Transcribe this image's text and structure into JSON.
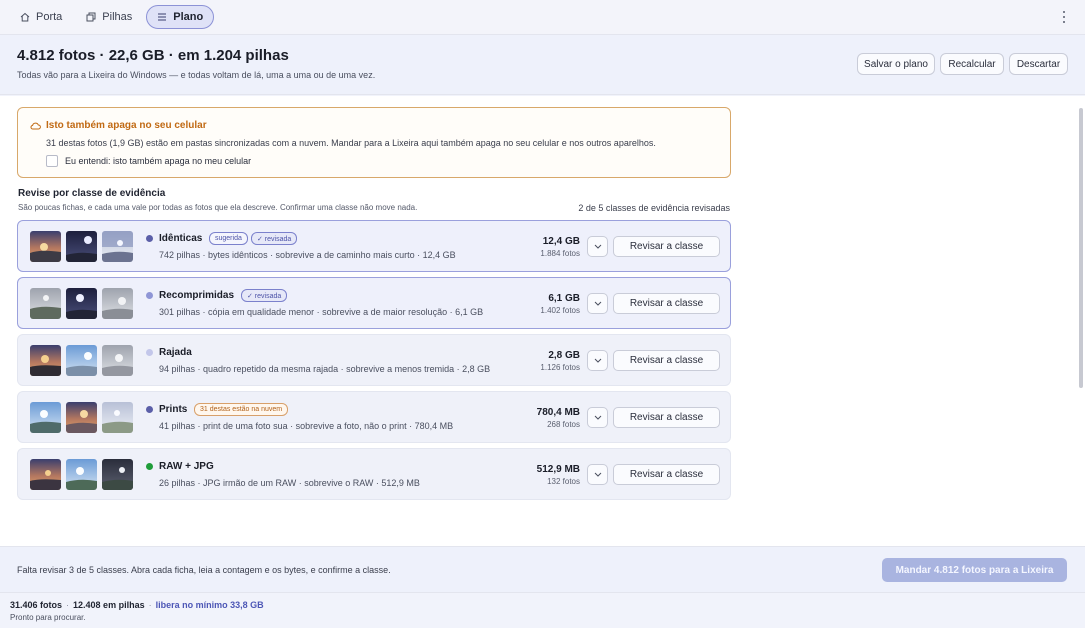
{
  "tabs": [
    {
      "label": "Porta",
      "icon": "home-icon",
      "active": false
    },
    {
      "label": "Pilhas",
      "icon": "stack-icon",
      "active": false
    },
    {
      "label": "Plano",
      "icon": "list-icon",
      "active": true
    }
  ],
  "header": {
    "title": "4.812 fotos · 22,6 GB · em 1.204 pilhas",
    "subtitle": "Todas vão para a Lixeira do Windows — e todas voltam de lá, uma a uma ou de uma vez.",
    "buttons": {
      "save": "Salvar o plano",
      "recalc": "Recalcular",
      "discard": "Descartar"
    }
  },
  "warning": {
    "title": "Isto também apaga no seu celular",
    "body": "31 destas fotos (1,9 GB) estão em pastas sincronizadas com a nuvem. Mandar para a Lixeira aqui também apaga no seu celular e nos outros aparelhos.",
    "checkbox_label": "Eu entendi: isto também apaga no meu celular",
    "accent": "#c16a14"
  },
  "section": {
    "title": "Revise por classe de evidência",
    "subtitle": "São poucas fichas, e cada uma vale por todas as fotos que ela descreve. Confirmar uma classe não move nada.",
    "progress": "2 de 5 classes de evidência revisadas"
  },
  "classes": [
    {
      "name": "Idênticas",
      "dot": "#5b5fa8",
      "badges": [
        "sugerida",
        "✓ revisada"
      ],
      "desc": "742 pilhas · bytes idênticos · sobrevive a de caminho mais curto · 12,4 GB",
      "size": "12,4 GB",
      "fotos": "1.884 fotos",
      "button": "Revisar a classe"
    },
    {
      "name": "Recomprimidas",
      "dot": "#8f96d6",
      "badges": [
        "✓ revisada"
      ],
      "desc": "301 pilhas · cópia em qualidade menor · sobrevive a de maior resolução · 6,1 GB",
      "size": "6,1 GB",
      "fotos": "1.402 fotos",
      "button": "Revisar a classe"
    },
    {
      "name": "Rajada",
      "dot": "#c3c7ea",
      "badges": [],
      "desc": "94 pilhas · quadro repetido da mesma rajada · sobrevive a menos tremida · 2,8 GB",
      "size": "2,8 GB",
      "fotos": "1.126 fotos",
      "button": "Revisar a classe"
    },
    {
      "name": "Prints",
      "dot": "#5b5fa8",
      "badges": [
        "31 destas estão na nuvem"
      ],
      "desc": "41 pilhas · print de uma foto sua · sobrevive a foto, não o print · 780,4 MB",
      "size": "780,4 MB",
      "fotos": "268 fotos",
      "button": "Revisar a classe"
    },
    {
      "name": "RAW + JPG",
      "dot": "#1f9d3a",
      "badges": [],
      "desc": "26 pilhas · JPG irmão de um RAW · sobrevive o RAW · 512,9 MB",
      "size": "512,9 MB",
      "fotos": "132 fotos",
      "button": "Revisar a classe"
    }
  ],
  "footer": {
    "message": "Falta revisar 3 de 5 classes. Abra cada ficha, leia a contagem e os bytes, e confirme a classe.",
    "send": "Mandar 4.812 fotos para a Lixeira"
  },
  "status": {
    "fotos": "31.406 fotos",
    "pilhas": "12.408 em pilhas",
    "libera": "libera no mínimo 33,8 GB",
    "ready": "Pronto para procurar."
  }
}
